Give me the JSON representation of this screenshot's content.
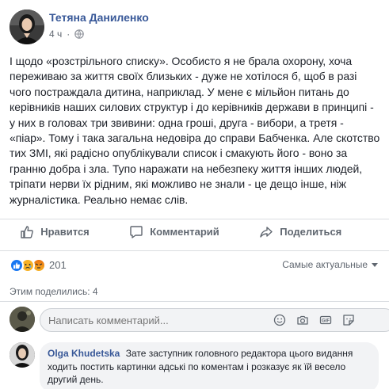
{
  "post": {
    "author": "Тетяна Даниленко",
    "time": "4 ч",
    "text": "І щодо «розстрільного списку». Особисто я не брала охорону, хоча переживаю за життя своїх близьких - дуже не хотілося б, щоб в разі чого постраждала дитина, наприклад. У мене є мільйон питань до керівників наших силових структур і до керівників держави в принципі - у них в головах три звивини: одна гроші, друга - вибори, а третя - «піар». Тому і така загальна недовіра до справи Бабченка. Але скотство тих ЗМІ, які радісно опублікували список і смакують його - воно за гранню добра і зла. Тупо наражати на небезпеку життя інших людей, тріпати нерви їх рідним, які можливо не знали - це дещо інше, ніж журналістика. Реально немає слів."
  },
  "actions": {
    "like": "Нравится",
    "comment": "Комментарий",
    "share": "Поделиться"
  },
  "reactions": {
    "count": "201",
    "sort_label": "Самые актуальные",
    "colors": {
      "like": "#1877f2",
      "sad": "#f7b125",
      "angry": "#e9710f"
    }
  },
  "shared": "Этим поделились: 4",
  "composer": {
    "placeholder": "Написать комментарий..."
  },
  "comment": {
    "author": "Olga Khudetska",
    "text": "Зате заступник головного редактора цього видання ходить постить картинки адські по коментам і розказує як їй весело другий день."
  }
}
